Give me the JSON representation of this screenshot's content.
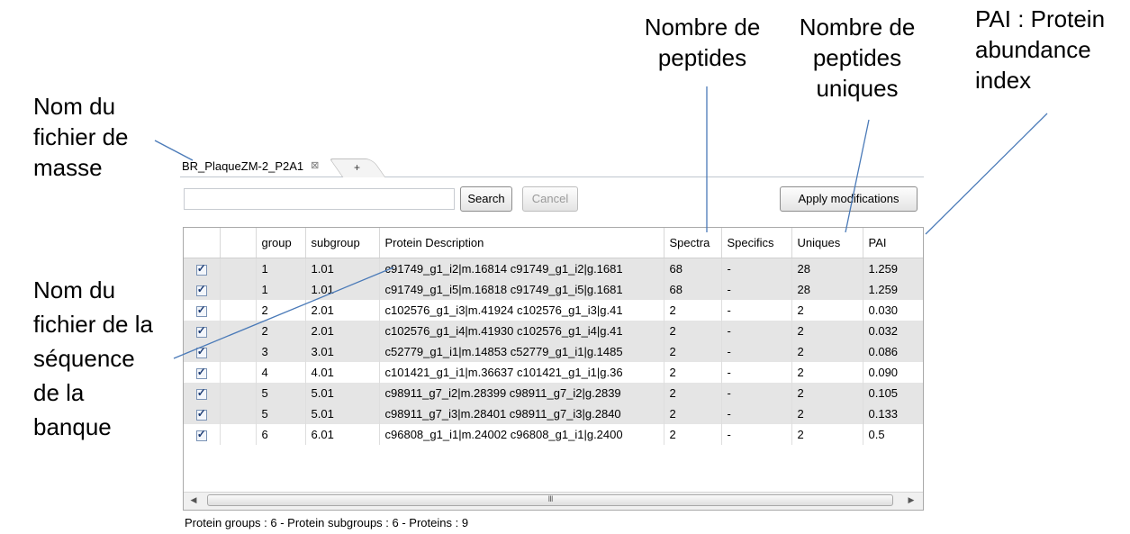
{
  "annotations": {
    "mass_file": [
      "Nom du",
      "fichier de",
      "masse"
    ],
    "sequence_file": [
      "Nom du",
      "fichier de la",
      "séquence",
      "de la",
      "banque"
    ],
    "peptide_count": [
      "Nombre de",
      "peptides"
    ],
    "unique_peptide_count": [
      "Nombre de",
      "peptides",
      "uniques"
    ],
    "pai": [
      "PAI : Protein",
      "abundance",
      "index"
    ]
  },
  "tabs": {
    "active_label": "BR_PlaqueZM-2_P2A1",
    "close_icon": "⊠",
    "add_label": "+"
  },
  "toolbar": {
    "search_value": "",
    "search_label": "Search",
    "cancel_label": "Cancel",
    "apply_label": "Apply modifications"
  },
  "table": {
    "columns": [
      "",
      "",
      "group",
      "subgroup",
      "Protein Description",
      "Spectra",
      "Specifics",
      "Uniques",
      "PAI"
    ],
    "rows": [
      {
        "checked": true,
        "group": "1",
        "subgroup": "1.01",
        "description": "c91749_g1_i2|m.16814 c91749_g1_i2|g.1681",
        "spectra": "68",
        "specifics": "-",
        "uniques": "28",
        "pai": "1.259"
      },
      {
        "checked": true,
        "group": "1",
        "subgroup": "1.01",
        "description": "c91749_g1_i5|m.16818 c91749_g1_i5|g.1681",
        "spectra": "68",
        "specifics": "-",
        "uniques": "28",
        "pai": "1.259"
      },
      {
        "checked": true,
        "group": "2",
        "subgroup": "2.01",
        "description": "c102576_g1_i3|m.41924 c102576_g1_i3|g.41",
        "spectra": "2",
        "specifics": "-",
        "uniques": "2",
        "pai": "0.030"
      },
      {
        "checked": true,
        "group": "2",
        "subgroup": "2.01",
        "description": "c102576_g1_i4|m.41930 c102576_g1_i4|g.41",
        "spectra": "2",
        "specifics": "-",
        "uniques": "2",
        "pai": "0.032"
      },
      {
        "checked": true,
        "group": "3",
        "subgroup": "3.01",
        "description": "c52779_g1_i1|m.14853 c52779_g1_i1|g.1485",
        "spectra": "2",
        "specifics": "-",
        "uniques": "2",
        "pai": "0.086"
      },
      {
        "checked": true,
        "group": "4",
        "subgroup": "4.01",
        "description": "c101421_g1_i1|m.36637 c101421_g1_i1|g.36",
        "spectra": "2",
        "specifics": "-",
        "uniques": "2",
        "pai": "0.090"
      },
      {
        "checked": true,
        "group": "5",
        "subgroup": "5.01",
        "description": "c98911_g7_i2|m.28399 c98911_g7_i2|g.2839",
        "spectra": "2",
        "specifics": "-",
        "uniques": "2",
        "pai": "0.105"
      },
      {
        "checked": true,
        "group": "5",
        "subgroup": "5.01",
        "description": "c98911_g7_i3|m.28401 c98911_g7_i3|g.2840",
        "spectra": "2",
        "specifics": "-",
        "uniques": "2",
        "pai": "0.133"
      },
      {
        "checked": true,
        "group": "6",
        "subgroup": "6.01",
        "description": "c96808_g1_i1|m.24002 c96808_g1_i1|g.2400",
        "spectra": "2",
        "specifics": "-",
        "uniques": "2",
        "pai": "0.5"
      }
    ],
    "scroll_thumb_glyph": "III",
    "scroll_left_glyph": "◀",
    "scroll_right_glyph": "▶"
  },
  "summary": "Protein groups : 6 - Protein subgroups : 6 - Proteins : 9"
}
